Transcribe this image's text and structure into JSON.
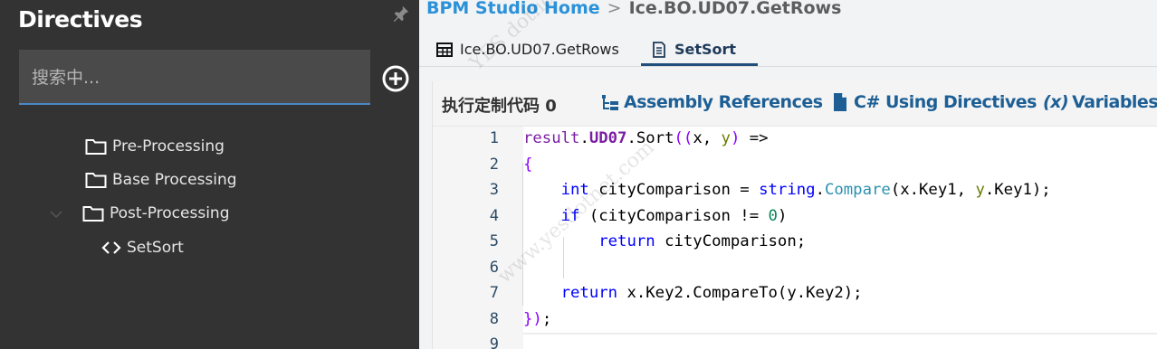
{
  "sidebar": {
    "title": "Directives",
    "search": {
      "placeholder": "搜索中...",
      "value": ""
    },
    "tree": [
      {
        "label": "Pre-Processing",
        "icon": "folder-icon"
      },
      {
        "label": "Base Processing",
        "icon": "folder-icon"
      },
      {
        "label": "Post-Processing",
        "icon": "folder-icon",
        "expanded": true
      },
      {
        "label": "SetSort",
        "icon": "code-icon"
      }
    ]
  },
  "breadcrumb": {
    "home": "BPM Studio Home",
    "separator": ">",
    "current": "Ice.BO.UD07.GetRows"
  },
  "tabs": [
    {
      "label": "Ice.BO.UD07.GetRows",
      "icon": "table-icon",
      "active": false
    },
    {
      "label": "SetSort",
      "icon": "document-icon",
      "active": true
    }
  ],
  "toolbar": {
    "title": "执行定制代码 0",
    "assembly_label": "Assembly References",
    "using_label": "C# Using Directives",
    "variables_prefix": "(x)",
    "variables_label": "Variables"
  },
  "code": {
    "line_numbers": [
      "1",
      "2",
      "3",
      "4",
      "5",
      "6",
      "7",
      "8",
      "9"
    ],
    "lines": [
      "result.UD07.Sort((x, y) =>",
      "{",
      "    int cityComparison = string.Compare(x.Key1, y.Key1);",
      "    if (cityComparison != 0)",
      "        return cityComparison;",
      "",
      "    return x.Key2.CompareTo(y.Key2);",
      "});",
      ""
    ]
  },
  "watermark": {
    "line1": "YES dotnet开发框架",
    "line2": "www.yesdotnet.com"
  },
  "colors": {
    "sidebar_bg": "#333333",
    "accent": "#2b91d8",
    "link": "#1d5f95",
    "keyword": "#0000ff"
  }
}
